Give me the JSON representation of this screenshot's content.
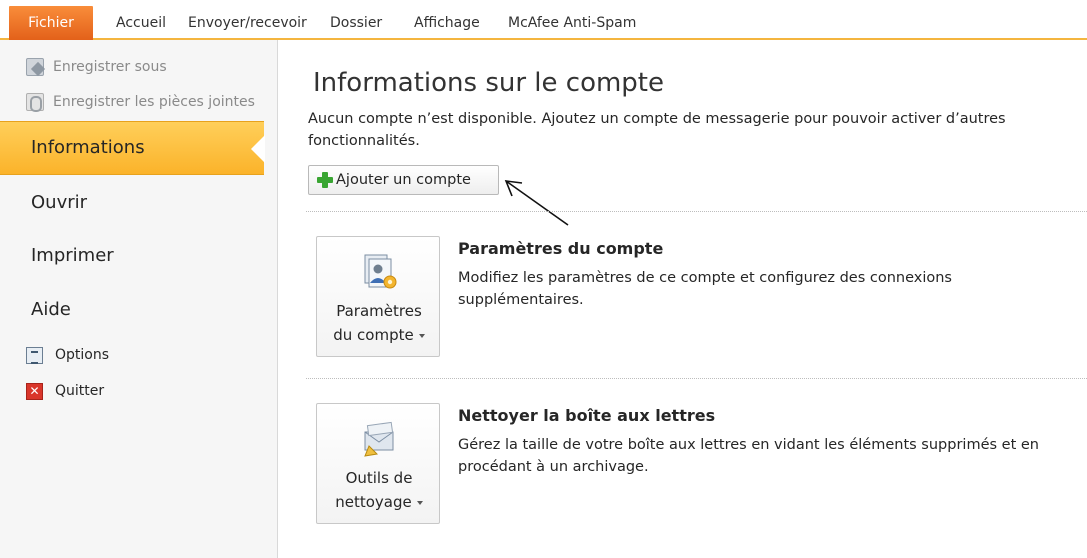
{
  "tabs": [
    "Fichier",
    "Accueil",
    "Envoyer/recevoir",
    "Dossier",
    "Affichage",
    "McAfee Anti-Spam"
  ],
  "sidebar": {
    "commands": [
      "Enregistrer sous",
      "Enregistrer les pièces jointes"
    ],
    "selected": "Informations",
    "nav": [
      "Ouvrir",
      "Imprimer",
      "Aide"
    ],
    "small": [
      "Options",
      "Quitter"
    ]
  },
  "main": {
    "title": "Informations sur le compte",
    "description": "Aucun compte n’est disponible. Ajoutez un compte de messagerie pour pouvoir activer d’autres fonctionnalités.",
    "add_button": "Ajouter un compte",
    "account": {
      "btn_line1": "Paramètres",
      "btn_line2": "du compte",
      "title": "Paramètres du compte",
      "desc": "Modifiez les paramètres de ce compte et configurez des connexions supplémentaires."
    },
    "cleanup": {
      "btn_line1": "Outils de",
      "btn_line2": "nettoyage",
      "title": "Nettoyer la boîte aux lettres",
      "desc": "Gérez la taille de votre boîte aux lettres en vidant les éléments supprimés et en procédant à un archivage."
    }
  },
  "colors": {
    "accent": "#fbb32a",
    "file_tab": "#e3611a"
  },
  "icons": [
    "save-as-icon",
    "attachments-icon",
    "options-icon",
    "exit-icon",
    "plus-icon",
    "account-settings-icon",
    "cleanup-tools-icon"
  ]
}
